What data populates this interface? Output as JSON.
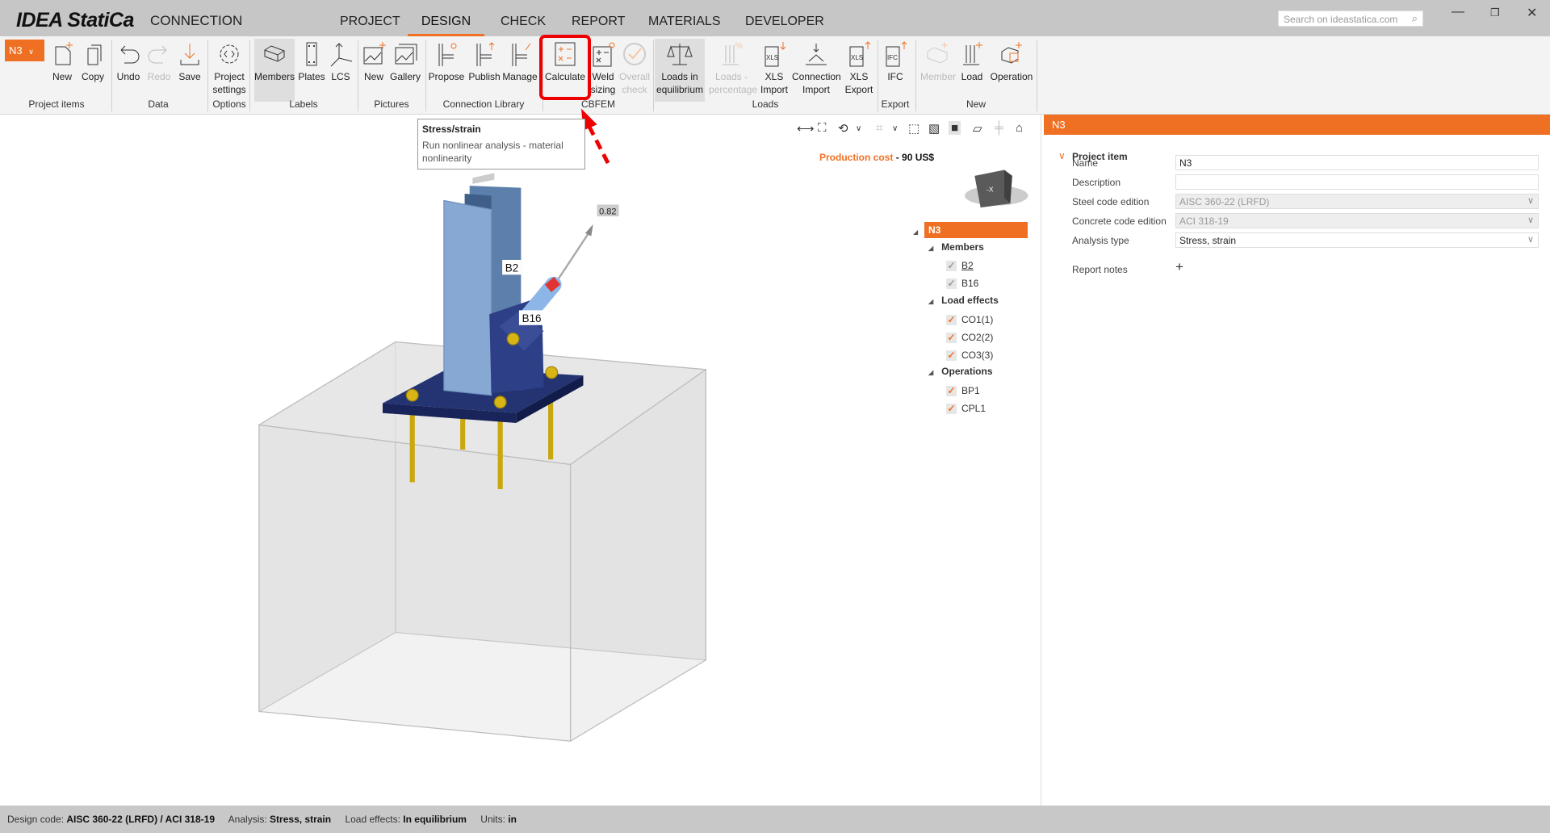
{
  "app": {
    "logo": "IDEA StatiCa",
    "product": "CONNECTION"
  },
  "menu_tabs": [
    {
      "label": "PROJECT"
    },
    {
      "label": "DESIGN",
      "active": true
    },
    {
      "label": "CHECK"
    },
    {
      "label": "REPORT"
    },
    {
      "label": "MATERIALS"
    },
    {
      "label": "DEVELOPER"
    }
  ],
  "search": {
    "placeholder": "Search on ideastatica.com"
  },
  "window": {
    "minimize": "—",
    "restore": "❐",
    "close": "✕"
  },
  "ribbon": {
    "project_item": "N3",
    "buttons": [
      {
        "label": "New",
        "icon": "new-item-icon"
      },
      {
        "label": "Copy",
        "icon": "copy-icon"
      },
      {
        "label": "Undo",
        "icon": "undo-icon"
      },
      {
        "label": "Redo",
        "icon": "redo-icon",
        "disabled": true
      },
      {
        "label": "Save",
        "icon": "save-icon"
      },
      {
        "label": "Project settings",
        "icon": "settings-gear-icon"
      },
      {
        "label": "Members",
        "icon": "member-box-icon",
        "highlighted": true
      },
      {
        "label": "Plates",
        "icon": "plate-icon"
      },
      {
        "label": "LCS",
        "icon": "lcs-axes-icon"
      },
      {
        "label": "New",
        "icon": "new-picture-icon"
      },
      {
        "label": "Gallery",
        "icon": "gallery-icon"
      },
      {
        "label": "Propose",
        "icon": "propose-icon"
      },
      {
        "label": "Publish",
        "icon": "publish-icon"
      },
      {
        "label": "Manage",
        "icon": "manage-icon"
      },
      {
        "label": "Calculate",
        "icon": "calculator-icon"
      },
      {
        "label": "Weld sizing",
        "icon": "weld-sizing-icon"
      },
      {
        "label": "Overall check",
        "icon": "overall-check-icon",
        "disabled": true
      },
      {
        "label": "Loads in equilibrium",
        "icon": "balance-scale-icon",
        "highlighted": true
      },
      {
        "label": "Loads - percentage",
        "icon": "loads-percentage-icon",
        "disabled": true
      },
      {
        "label": "XLS Import",
        "icon": "xls-import-icon"
      },
      {
        "label": "Connection Import",
        "icon": "connection-import-icon"
      },
      {
        "label": "XLS Export",
        "icon": "xls-export-icon"
      },
      {
        "label": "IFC",
        "icon": "ifc-export-icon"
      },
      {
        "label": "Member",
        "icon": "new-member-icon",
        "disabled": true
      },
      {
        "label": "Load",
        "icon": "new-load-icon"
      },
      {
        "label": "Operation",
        "icon": "new-operation-icon"
      }
    ],
    "groups": [
      "Project items",
      "Data",
      "Options",
      "Labels",
      "Pictures",
      "Connection Library",
      "CBFEM",
      "Loads",
      "Export",
      "New"
    ]
  },
  "tooltip": {
    "title": "Stress/strain",
    "description": "Run nonlinear analysis - material nonlinearity"
  },
  "viewport": {
    "production_cost_label": "Production cost",
    "production_cost_sep": "-",
    "production_cost_value": "90 US$",
    "navcube_label": "-X",
    "member_labels": [
      "B2",
      "B16"
    ],
    "force_value": "0.82"
  },
  "tree": {
    "root": "N3",
    "sections": [
      {
        "title": "Members",
        "items": [
          {
            "label": "B2",
            "checked": true
          },
          {
            "label": "B16",
            "checked": true
          }
        ]
      },
      {
        "title": "Load effects",
        "items": [
          {
            "label": "CO1(1)",
            "checked": true
          },
          {
            "label": "CO2(2)",
            "checked": true
          },
          {
            "label": "CO3(3)",
            "checked": true
          }
        ]
      },
      {
        "title": "Operations",
        "items": [
          {
            "label": "BP1",
            "checked": true
          },
          {
            "label": "CPL1",
            "checked": true
          }
        ]
      }
    ]
  },
  "panel": {
    "header": "N3",
    "section": "Project item",
    "fields": [
      {
        "label": "Name",
        "value": "N3"
      },
      {
        "label": "Description",
        "value": ""
      },
      {
        "label": "Steel code edition",
        "value": "AISC 360-22 (LRFD)",
        "disabled": true,
        "dropdown": true
      },
      {
        "label": "Concrete code edition",
        "value": "ACI 318-19",
        "disabled": true,
        "dropdown": true
      },
      {
        "label": "Analysis type",
        "value": "Stress, strain",
        "dropdown": true
      }
    ],
    "report_notes_label": "Report notes",
    "report_notes_add": "+"
  },
  "status": {
    "design_code_label": "Design code:",
    "design_code": "AISC 360-22 (LRFD) / ACI 318-19",
    "analysis_label": "Analysis:",
    "analysis": "Stress, strain",
    "load_effects_label": "Load effects:",
    "load_effects": "In equilibrium",
    "units_label": "Units:",
    "units": "in"
  },
  "colors": {
    "accent": "#f07023",
    "highlight_red": "#e00000",
    "steel": "#7ea0cc",
    "plate": "#1f2d6b",
    "bolt": "#c9a80f"
  }
}
